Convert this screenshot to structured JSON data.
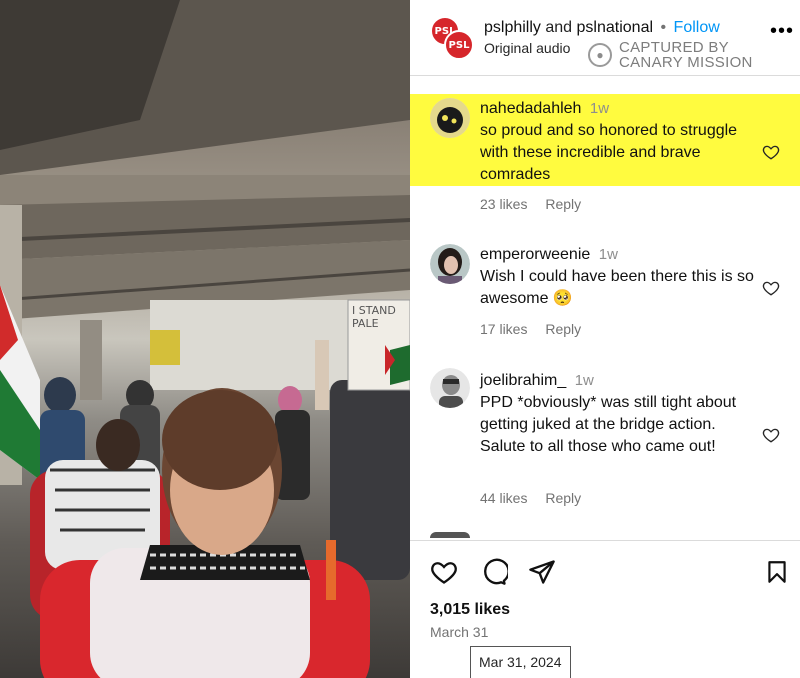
{
  "header": {
    "user1": "pslphilly",
    "and": "and",
    "user2": "pslnational",
    "dot": "•",
    "follow_label": "Follow",
    "audio": "Original audio",
    "avatar_text": "PSL",
    "more": "•••"
  },
  "watermark": {
    "text": "CAPTURED BY\nCANARY MISSION"
  },
  "media": {
    "sign_text": "I STAND\nPALE"
  },
  "comments": [
    {
      "user": "nahedadahleh",
      "time": "1w",
      "text": "so proud and so honored to struggle with these incredible and brave comrades",
      "likes": "23 likes",
      "reply": "Reply",
      "highlighted": true
    },
    {
      "user": "emperorweenie",
      "time": "1w",
      "text": "Wish I could have been there this is so awesome 🥺",
      "likes": "17 likes",
      "reply": "Reply",
      "highlighted": false
    },
    {
      "user": "joelibrahim_",
      "time": "1w",
      "text": "PPD *obviously* was still tight about getting juked at the bridge action. Salute to all those who came out!",
      "likes": "44 likes",
      "reply": "Reply",
      "highlighted": false
    }
  ],
  "footer": {
    "likes": "3,015 likes",
    "date": "March 31",
    "tooltip": "Mar 31, 2024"
  },
  "colors": {
    "follow": "#0095f6",
    "highlight": "#fffb3f",
    "psl_red": "#d6262b"
  }
}
